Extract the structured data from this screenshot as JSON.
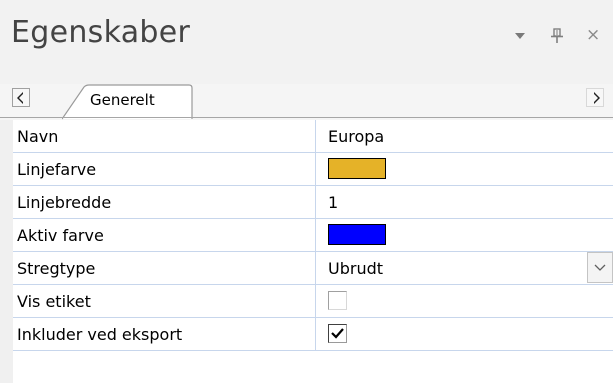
{
  "panel": {
    "title": "Egenskaber",
    "icons": {
      "dropdown": "dropdown-arrow-icon",
      "pin": "pin-icon",
      "close": "close-icon",
      "close_glyph": "×"
    }
  },
  "tabs": {
    "active_label": "Generelt",
    "scroll_left_icon": "scroll-left-icon",
    "scroll_right_icon": "scroll-right-icon"
  },
  "properties": [
    {
      "name": "Navn",
      "value": "Europa",
      "type": "text"
    },
    {
      "name": "Linjefarve",
      "type": "color",
      "color": "#e5b228"
    },
    {
      "name": "Linjebredde",
      "value": "1",
      "type": "text"
    },
    {
      "name": "Aktiv farve",
      "type": "color",
      "color": "#0000ff"
    },
    {
      "name": "Stregtype",
      "value": "Ubrudt",
      "type": "dropdown"
    },
    {
      "name": "Vis etiket",
      "type": "checkbox",
      "checked": false
    },
    {
      "name": "Inkluder ved eksport",
      "type": "checkbox",
      "checked": true
    }
  ],
  "colors": {
    "line_color": "#e5b228",
    "active_color": "#0000ff",
    "grid_line": "#c7d6ec"
  }
}
